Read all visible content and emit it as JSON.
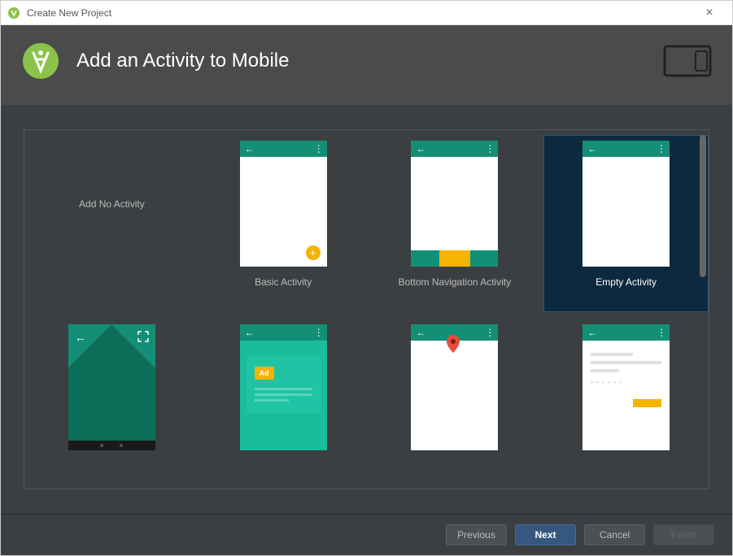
{
  "window": {
    "title": "Create New Project"
  },
  "header": {
    "title": "Add an Activity to Mobile"
  },
  "activities": [
    {
      "label": "Add No Activity",
      "selected": false
    },
    {
      "label": "Basic Activity",
      "selected": false
    },
    {
      "label": "Bottom Navigation Activity",
      "selected": false
    },
    {
      "label": "Empty Activity",
      "selected": true
    },
    {
      "label": "",
      "selected": false
    },
    {
      "label": "",
      "selected": false
    },
    {
      "label": "",
      "selected": false
    },
    {
      "label": "",
      "selected": false
    }
  ],
  "ad_badge": "Ad",
  "footer": {
    "previous": "Previous",
    "next": "Next",
    "cancel": "Cancel",
    "finish": "Finish"
  }
}
